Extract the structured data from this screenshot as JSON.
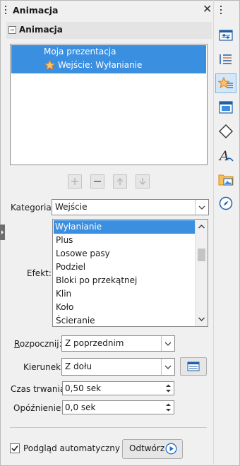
{
  "panel": {
    "title": "Animacja"
  },
  "section": {
    "title": "Animacja"
  },
  "animation_list": {
    "rows": [
      "Moja prezentacja",
      "Wejście: Wyłanianie"
    ]
  },
  "labels": {
    "category": "Kategoria:",
    "effect": "Efekt:",
    "start": "Rozpocznij:",
    "direction": "Kierunek:",
    "duration": "Czas trwania:",
    "delay": "Opóźnienie:",
    "autopreview": "Podgląd automatyczny",
    "play": "Odtwórz"
  },
  "category": {
    "value": "Wejście"
  },
  "effects": {
    "items": [
      "Wyłanianie",
      "Plus",
      "Losowe pasy",
      "Podziel",
      "Bloki po przekątnej",
      "Klin",
      "Koło",
      "Ścieranie"
    ],
    "selected": 0
  },
  "start": {
    "value": "Z poprzednim"
  },
  "direction": {
    "value": "Z dołu"
  },
  "duration": {
    "value": "0,50 sek"
  },
  "delay": {
    "value": "0,0 sek"
  },
  "autopreview": {
    "checked": true
  },
  "deck_icons": [
    "properties-icon",
    "styles-icon",
    "animation-icon",
    "master-slides-icon",
    "shapes-icon",
    "fontwork-icon",
    "gallery-icon",
    "navigator-icon"
  ],
  "colors": {
    "selection": "#3b8fe0",
    "accent_blue": "#1f6fc6",
    "star_orange": "#f59b1a"
  }
}
